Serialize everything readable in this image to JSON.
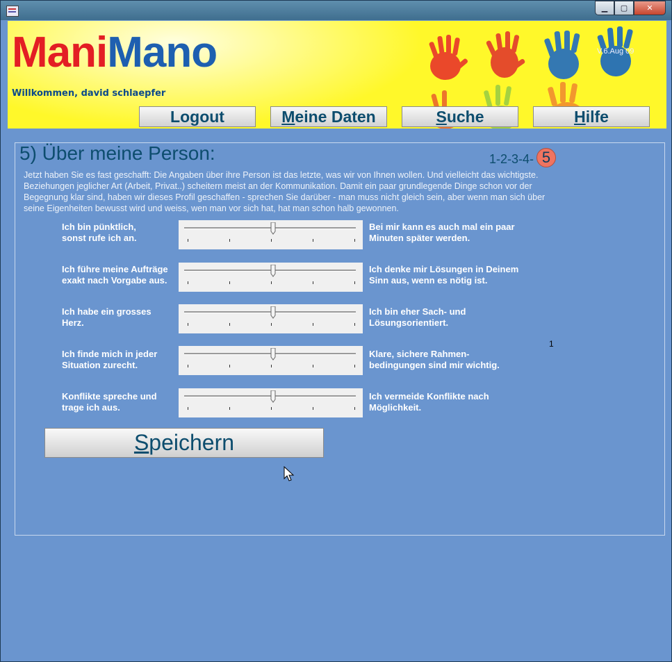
{
  "window": {
    "minimize": "▁",
    "maximize": "▢",
    "close": "✕"
  },
  "banner": {
    "logo_part1": "Mani",
    "logo_part2": "Mano",
    "welcome": "Willkommen, david schlaepfer",
    "version": "V.6.Aug 09"
  },
  "nav": [
    {
      "label": "Logout",
      "accel": "",
      "rest": "Logout"
    },
    {
      "label": "Meine Daten",
      "accel": "M",
      "rest": "eine Daten"
    },
    {
      "label": "Suche",
      "accel": "S",
      "rest": "uche"
    },
    {
      "label": "Hilfe",
      "accel": "H",
      "rest": "ilfe"
    }
  ],
  "form": {
    "heading": "5) Über meine Person:",
    "steps_prefix": "1-2-3-4-",
    "steps_current": "5",
    "intro": "Jetzt haben Sie es fast geschafft: Die Angaben über ihre Person ist das letzte, was wir von Ihnen wollen. Und vielleicht das wichtigste.\nBeziehungen jeglicher Art (Arbeit, Privat..) scheitern meist an der Kommunikation. Damit ein paar grundlegende Dinge schon vor der\nBegegnung klar sind, haben wir dieses Profil geschaffen - sprechen Sie darüber - man muss nicht gleich sein, aber wenn man sich über\nseine Eigenheiten bewusst wird und weiss, wen man vor sich hat, hat man schon halb gewonnen.",
    "sliders": [
      {
        "left": "Ich bin pünktlich,\nsonst rufe ich an.",
        "right": "Bei mir kann es auch mal ein paar\nMinuten später werden.",
        "value": 0.5
      },
      {
        "left": "Ich führe meine Aufträge\nexakt nach Vorgabe aus.",
        "right": "Ich denke mir Lösungen in Deinem\nSinn aus, wenn es nötig ist.",
        "value": 0.5
      },
      {
        "left": "Ich habe ein grosses\nHerz.",
        "right": "Ich bin eher Sach- und\nLösungsorientiert.",
        "value": 0.5
      },
      {
        "left": "Ich finde mich in jeder\nSituation zurecht.",
        "right": "Klare, sichere Rahmen-\nbedingungen sind mir wichtig.",
        "value": 0.5
      },
      {
        "left": "Konflikte spreche und\ntrage ich aus.",
        "right": "Ich vermeide Konflikte nach\nMöglichkeit.",
        "value": 0.5
      }
    ],
    "page_number": "1",
    "save_accel": "S",
    "save_rest": "peichern"
  },
  "colors": {
    "banner": "#fff82a",
    "mani": "#e31e24",
    "mano": "#1e5fb0",
    "form_bg": "#6a95cf",
    "button_text": "#0d4d6e"
  }
}
